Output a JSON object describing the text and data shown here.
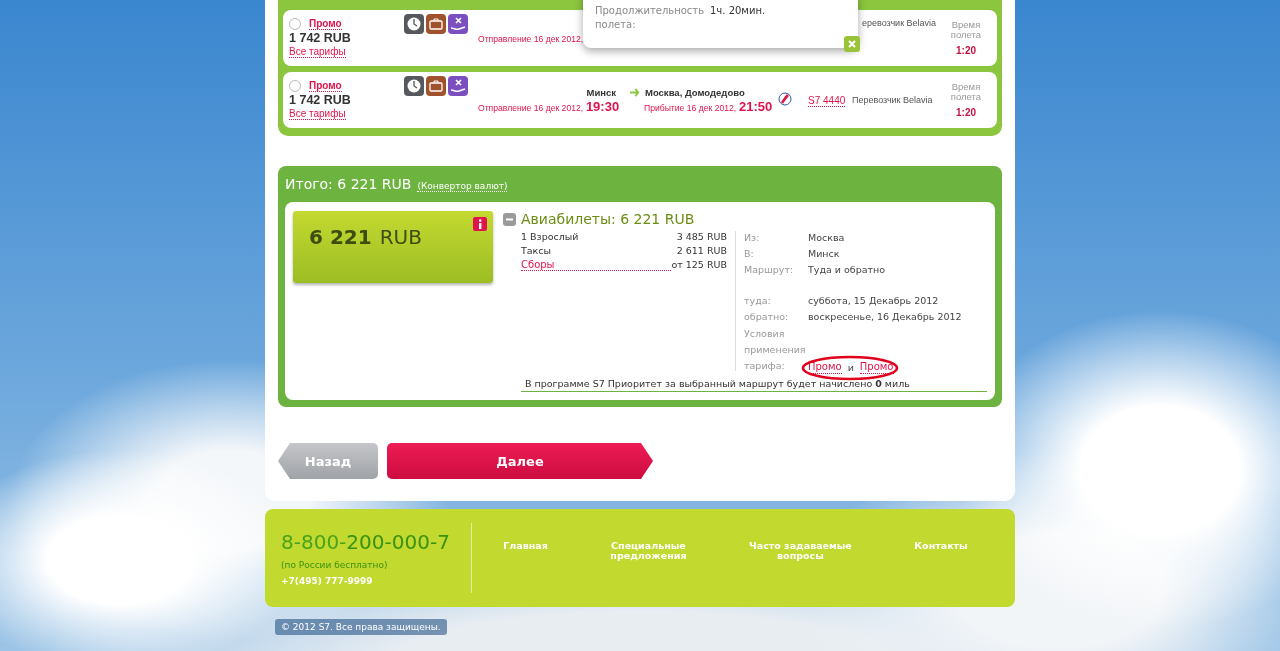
{
  "flights": [
    {
      "selected": false,
      "fare": "Промо",
      "price": "1 742 RUB",
      "all_fares": "Все тарифы",
      "departure_label": "Отправление 16 дек 2012,",
      "carrier": "еревозчик Belavia",
      "duration_label": "Время полета",
      "duration": "1:20"
    },
    {
      "selected": false,
      "fare": "Промо",
      "price": "1 742 RUB",
      "all_fares": "Все тарифы",
      "from": "Минск",
      "to": "Москва, Домодедово",
      "departure_label": "Отправление 16 дек 2012,",
      "departure_time": "19:30",
      "arrival_label": "Прибытие 16 дек 2012,",
      "arrival_time": "21:50",
      "flight_number": "S7 4440",
      "carrier": "Перевозчик Belavia",
      "duration_label": "Время полета",
      "duration": "1:20"
    }
  ],
  "popup": {
    "rows": [
      {
        "label": "Продолжительность полета:",
        "value": "1ч. 20мин."
      }
    ]
  },
  "total": {
    "title": "Итого: 6 221 RUB",
    "converter": "(Конвертор валют)",
    "amount": "6 221",
    "currency": "RUB",
    "tickets": {
      "title": "Авиабилеты: 6 221 RUB",
      "expanded": true,
      "lines": [
        {
          "kind": "text",
          "label": "1 Взрослый",
          "value": "3 485 RUB"
        },
        {
          "kind": "text",
          "label": "Таксы",
          "value": "2 611 RUB"
        },
        {
          "kind": "link",
          "label": "Сборы",
          "value": "от 125 RUB"
        }
      ],
      "details": [
        {
          "label": "Из:",
          "value": "Москва"
        },
        {
          "label": "В:",
          "value": "Минск"
        },
        {
          "label": "Маршрут:",
          "value": "Туда и обратно"
        }
      ],
      "dates": [
        {
          "label": "туда:",
          "value": "суббота, 15 Декабрь 2012"
        },
        {
          "label": "обратно:",
          "value": "воскресенье, 16 Декабрь 2012"
        }
      ],
      "conditions": {
        "label": "Условия применения тарифа:",
        "first": "Промо",
        "joiner": "и",
        "second": "Промо"
      },
      "miles_note": "В программе S7 Приоритет за выбранный маршрут будет начислено **0** миль"
    }
  },
  "buttons": {
    "back": "Назад",
    "next": "Далее"
  },
  "footer": {
    "phone": "8-800-**200-000-7**",
    "phone_note": "(по России бесплатно)",
    "phone_alt": "+7(495) 777-9999",
    "links": [
      [
        "Главная"
      ],
      [
        "Специальные",
        "предложения"
      ],
      [
        "Часто задаваемые",
        "вопросы"
      ],
      [
        "Контакты"
      ]
    ]
  },
  "copyright": "© 2012 S7. Все права защищены."
}
